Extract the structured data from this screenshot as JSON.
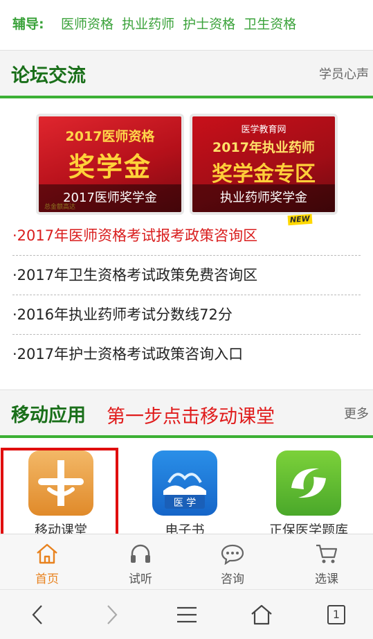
{
  "tutoring": {
    "label": "辅导:",
    "links": [
      "医师资格",
      "执业药师",
      "护士资格",
      "卫生资格"
    ]
  },
  "forum": {
    "title": "论坛交流",
    "more": "学员心声",
    "banners": [
      {
        "big_text": "2017医师资格",
        "accent_text": "奖学金",
        "footnote": "总金额高达",
        "caption": "2017医师奖学金"
      },
      {
        "big_text": "2017年执业药师",
        "accent_text": "奖学金专区",
        "brand": "医学教育网",
        "caption": "执业药师奖学金"
      }
    ],
    "items": [
      "·2017年医师资格考试报考政策咨询区",
      "·2017年卫生资格考试政策免费咨询区",
      "·2016年执业药师考试分数线72分",
      "·2017年护士资格考试政策咨询入口"
    ],
    "new_badge": "NEW"
  },
  "mobile": {
    "title": "移动应用",
    "hint": "第一步点击移动课堂",
    "more": "更多",
    "apps": [
      {
        "name": "移动课堂",
        "icon": "cross-logo-icon"
      },
      {
        "name": "电子书",
        "icon": "book-icon",
        "icon_text": "医 学"
      },
      {
        "name": "正保医学题库",
        "icon": "swirl-logo-icon"
      }
    ]
  },
  "tabbar": {
    "tabs": [
      {
        "label": "首页",
        "icon": "home-icon",
        "active": true
      },
      {
        "label": "试听",
        "icon": "headphones-icon",
        "active": false
      },
      {
        "label": "咨询",
        "icon": "chat-icon",
        "active": false
      },
      {
        "label": "选课",
        "icon": "cart-icon",
        "active": false
      }
    ]
  },
  "browser": {
    "tab_count": "1"
  },
  "colors": {
    "accent_green": "#3cb034",
    "active_orange": "#e8821e",
    "highlight_red": "#e00d0d"
  }
}
